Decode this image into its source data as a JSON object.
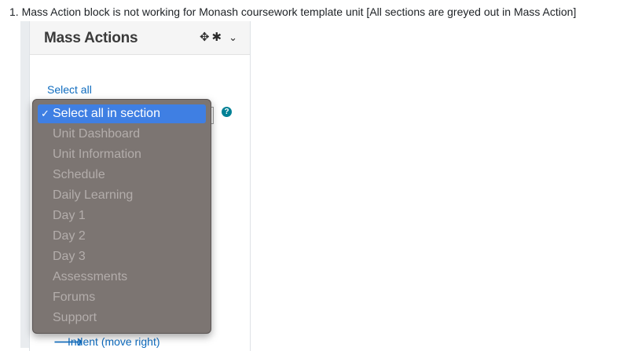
{
  "issue": {
    "text": "1. Mass Action block is not working for Monash coursework template unit [All sections are greyed out in Mass Action]"
  },
  "block": {
    "title": "Mass Actions",
    "move_icon": "move-icon",
    "gear_icon": "gear-icon",
    "chevron_icon": "chevron-down-icon",
    "select_all": "Select all",
    "help_icon": "?",
    "indent_label": "Indent (move right)"
  },
  "dropdown": {
    "checkmark": "✓",
    "selected": "Select all in section",
    "options": [
      "Select all in section",
      "Unit Dashboard",
      "Unit Information",
      "Schedule",
      "Daily Learning",
      "Day 1",
      "Day 2",
      "Day 3",
      "Assessments",
      "Forums",
      "Support"
    ]
  },
  "colors": {
    "link": "#0f6cbf",
    "selected_bg": "#3f7fe3",
    "dropdown_bg": "#7c7572",
    "disabled_text": "#b3adab",
    "help": "#008196"
  }
}
